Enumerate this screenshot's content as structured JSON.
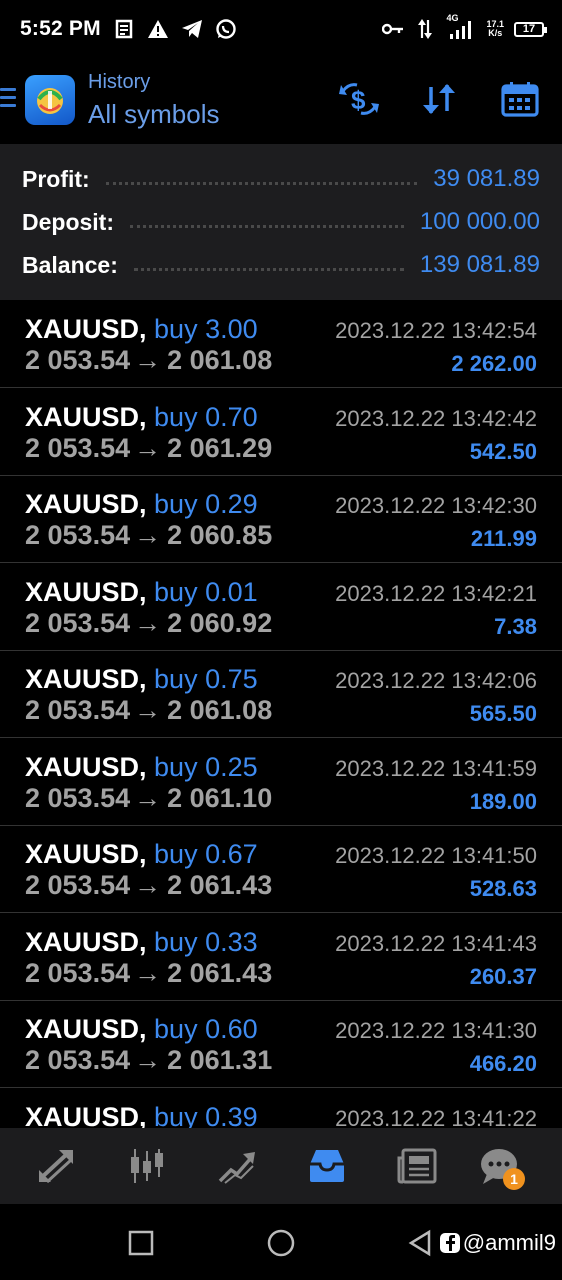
{
  "status_bar": {
    "time": "5:52 PM",
    "network": "4G",
    "speed_value": "17.1",
    "speed_unit": "K/s",
    "battery": "17",
    "icons": [
      "notes-icon",
      "warning-icon",
      "telegram-icon",
      "whatsapp-icon",
      "key-icon",
      "data-transfer-icon",
      "signal-icon"
    ]
  },
  "header": {
    "subtitle": "History",
    "title": "All symbols",
    "actions": [
      "dollar-swap-icon",
      "sort-icon",
      "calendar-icon"
    ]
  },
  "summary": {
    "profit_label": "Profit:",
    "profit_value": "39 081.89",
    "deposit_label": "Deposit:",
    "deposit_value": "100 000.00",
    "balance_label": "Balance:",
    "balance_value": "139 081.89"
  },
  "trades": [
    {
      "symbol": "XAUUSD,",
      "type": "buy 3.00",
      "open": "2 053.54",
      "arrow": "→",
      "close": "2 061.08",
      "time": "2023.12.22 13:42:54",
      "profit": "2 262.00"
    },
    {
      "symbol": "XAUUSD,",
      "type": "buy 0.70",
      "open": "2 053.54",
      "arrow": "→",
      "close": "2 061.29",
      "time": "2023.12.22 13:42:42",
      "profit": "542.50"
    },
    {
      "symbol": "XAUUSD,",
      "type": "buy 0.29",
      "open": "2 053.54",
      "arrow": "→",
      "close": "2 060.85",
      "time": "2023.12.22 13:42:30",
      "profit": "211.99"
    },
    {
      "symbol": "XAUUSD,",
      "type": "buy 0.01",
      "open": "2 053.54",
      "arrow": "→",
      "close": "2 060.92",
      "time": "2023.12.22 13:42:21",
      "profit": "7.38"
    },
    {
      "symbol": "XAUUSD,",
      "type": "buy 0.75",
      "open": "2 053.54",
      "arrow": "→",
      "close": "2 061.08",
      "time": "2023.12.22 13:42:06",
      "profit": "565.50"
    },
    {
      "symbol": "XAUUSD,",
      "type": "buy 0.25",
      "open": "2 053.54",
      "arrow": "→",
      "close": "2 061.10",
      "time": "2023.12.22 13:41:59",
      "profit": "189.00"
    },
    {
      "symbol": "XAUUSD,",
      "type": "buy 0.67",
      "open": "2 053.54",
      "arrow": "→",
      "close": "2 061.43",
      "time": "2023.12.22 13:41:50",
      "profit": "528.63"
    },
    {
      "symbol": "XAUUSD,",
      "type": "buy 0.33",
      "open": "2 053.54",
      "arrow": "→",
      "close": "2 061.43",
      "time": "2023.12.22 13:41:43",
      "profit": "260.37"
    },
    {
      "symbol": "XAUUSD,",
      "type": "buy 0.60",
      "open": "2 053.54",
      "arrow": "→",
      "close": "2 061.31",
      "time": "2023.12.22 13:41:30",
      "profit": "466.20"
    },
    {
      "symbol": "XAUUSD,",
      "type": "buy 0.39",
      "open": "",
      "arrow": "",
      "close": "",
      "time": "2023.12.22 13:41:22",
      "profit": ""
    }
  ],
  "bottom_nav": {
    "items": [
      "quotes-icon",
      "chart-icon",
      "trade-icon",
      "history-icon",
      "news-icon",
      "messages-icon"
    ],
    "active": "history-icon",
    "messages_badge": "1"
  },
  "watermark": "@ammil9",
  "colors": {
    "accent": "#3f8bf0",
    "header_text": "#6b9ee8",
    "summary_bg": "#1d1d1f",
    "nav_bg": "#1c1c1e",
    "muted": "#a3a3a3",
    "badge": "#f0921e"
  }
}
